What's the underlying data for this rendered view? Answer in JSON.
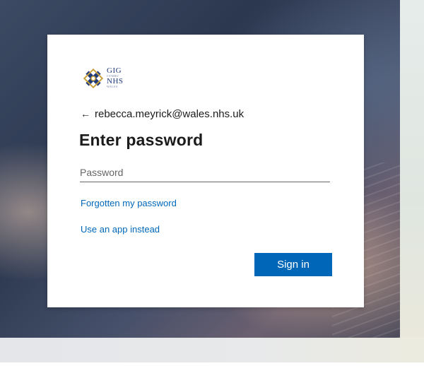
{
  "colors": {
    "accent": "#0067b8",
    "text": "#1b1b1b",
    "card": "#ffffff"
  },
  "logo": {
    "line1": "GIG",
    "line2": "CYMRU",
    "line3": "NHS",
    "line4": "WALES",
    "icon": "nhs-wales-knot-icon"
  },
  "identity": {
    "back_icon": "back-arrow-icon",
    "back_glyph": "←",
    "email": "rebecca.meyrick@wales.nhs.uk"
  },
  "title": "Enter password",
  "password": {
    "placeholder": "Password",
    "value": ""
  },
  "links": {
    "forgot": "Forgotten my password",
    "app": "Use an app instead"
  },
  "signin_label": "Sign in"
}
